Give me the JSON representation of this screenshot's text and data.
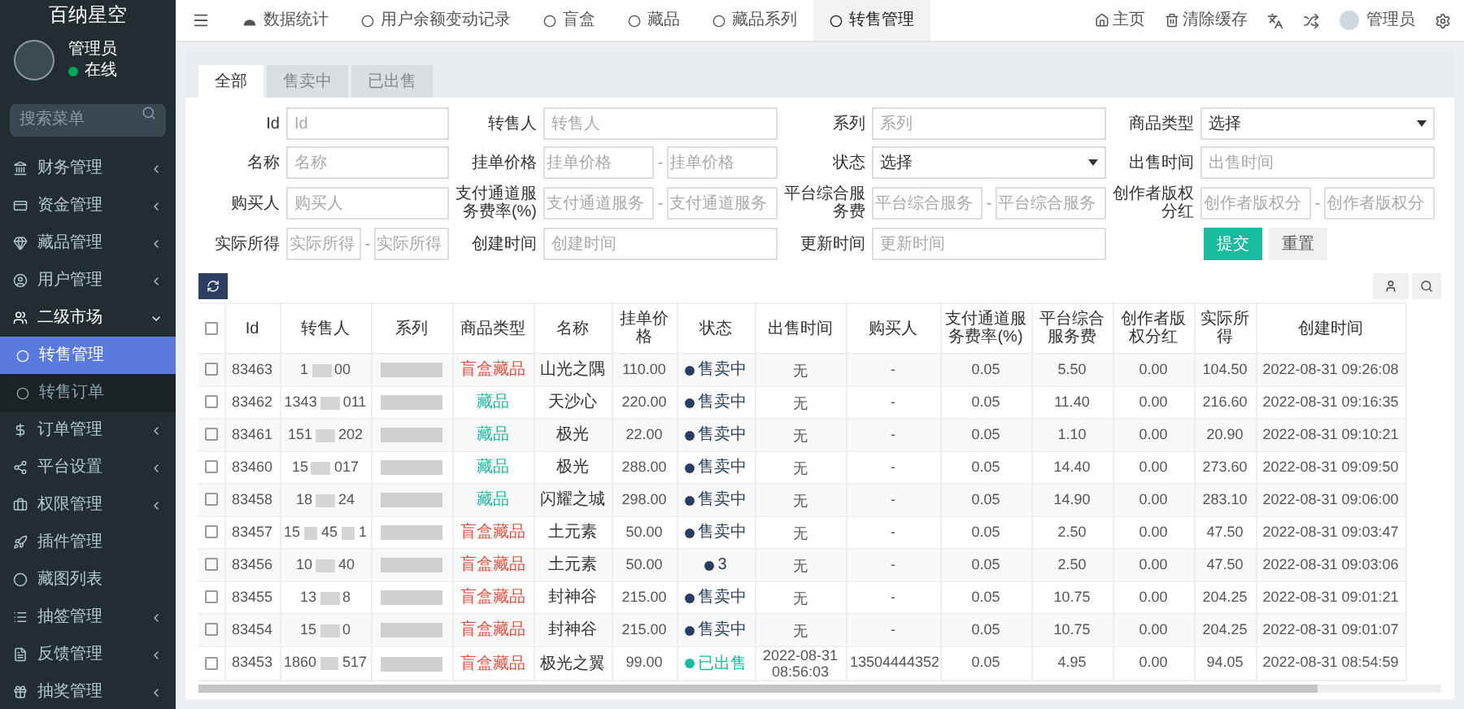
{
  "sidebar": {
    "brand": "百纳星空",
    "user": {
      "name": "管理员",
      "status": "在线",
      "online": true
    },
    "search": {
      "placeholder": "搜索菜单"
    },
    "items": [
      {
        "label": "财务管理",
        "expandable": true,
        "expanded": false
      },
      {
        "label": "资金管理",
        "expandable": true,
        "expanded": false
      },
      {
        "label": "藏品管理",
        "expandable": true,
        "expanded": false
      },
      {
        "label": "用户管理",
        "expandable": true,
        "expanded": false
      },
      {
        "label": "二级市场",
        "expandable": true,
        "expanded": true,
        "children": [
          {
            "label": "转售管理",
            "selected": true
          },
          {
            "label": "转售订单",
            "selected": false
          }
        ]
      },
      {
        "label": "订单管理",
        "expandable": true,
        "expanded": false
      },
      {
        "label": "平台设置",
        "expandable": true,
        "expanded": false
      },
      {
        "label": "权限管理",
        "expandable": true,
        "expanded": false
      },
      {
        "label": "插件管理",
        "expandable": false,
        "expanded": false
      },
      {
        "label": "藏图列表",
        "expandable": false,
        "expanded": false
      },
      {
        "label": "抽签管理",
        "expandable": true,
        "expanded": false
      },
      {
        "label": "反馈管理",
        "expandable": true,
        "expanded": false
      },
      {
        "label": "抽奖管理",
        "expandable": true,
        "expanded": false
      }
    ]
  },
  "top_tabs": [
    {
      "label": "数据统计",
      "selected": false
    },
    {
      "label": "用户余额变动记录",
      "selected": false
    },
    {
      "label": "盲盒",
      "selected": false
    },
    {
      "label": "藏品",
      "selected": false
    },
    {
      "label": "藏品系列",
      "selected": false
    },
    {
      "label": "转售管理",
      "selected": true
    }
  ],
  "top_right": {
    "home": "主页",
    "clear_cache": "清除缓存",
    "user": "管理员"
  },
  "filter_tabs": [
    {
      "label": "全部",
      "selected": true
    },
    {
      "label": "售卖中",
      "selected": false
    },
    {
      "label": "已出售",
      "selected": false
    }
  ],
  "filters": [
    {
      "label": "Id",
      "kind": "text",
      "placeholder": "Id"
    },
    {
      "label": "转售人",
      "kind": "text",
      "placeholder": "转售人"
    },
    {
      "label": "系列",
      "kind": "text",
      "placeholder": "系列"
    },
    {
      "label": "商品类型",
      "kind": "select",
      "value": "选择"
    },
    {
      "label": "名称",
      "kind": "text",
      "placeholder": "名称"
    },
    {
      "label": "挂单价格",
      "kind": "range",
      "placeholders": [
        "挂单价格",
        "挂单价格"
      ],
      "separator": "-"
    },
    {
      "label": "状态",
      "kind": "select",
      "value": "选择"
    },
    {
      "label": "出售时间",
      "kind": "text",
      "placeholder": "出售时间"
    },
    {
      "label": "购买人",
      "kind": "text",
      "placeholder": "购买人"
    },
    {
      "label": "支付通道服务费率(%)",
      "kind": "range",
      "placeholders": [
        "支付通道服务",
        "支付通道服务"
      ],
      "separator": "-"
    },
    {
      "label": "平台综合服务费",
      "kind": "range",
      "placeholders": [
        "平台综合服务",
        "平台综合服务"
      ],
      "separator": "-"
    },
    {
      "label": "创作者版权分红",
      "kind": "range",
      "placeholders": [
        "创作者版权分",
        "创作者版权分"
      ],
      "separator": "-"
    },
    {
      "label": "实际所得",
      "kind": "range",
      "placeholders": [
        "实际所得",
        "实际所得"
      ],
      "separator": "-"
    },
    {
      "label": "创建时间",
      "kind": "text",
      "placeholder": "创建时间"
    },
    {
      "label": "更新时间",
      "kind": "text",
      "placeholder": "更新时间"
    }
  ],
  "filter_buttons": {
    "submit": "提交",
    "reset": "重置"
  },
  "table": {
    "select_all": {
      "checked": false
    },
    "columns": [
      "Id",
      "转售人",
      "系列",
      "商品类型",
      "名称",
      "挂单价格",
      "状态",
      "出售时间",
      "购买人",
      "支付通道服务费率(%)",
      "平台综合服务费",
      "创作者版权分红",
      "实际所得",
      "创建时间"
    ],
    "rows": [
      {
        "checked": false,
        "id": "83463",
        "seller": [
          "1",
          "00"
        ],
        "series_blurred": true,
        "type": {
          "label": "盲盒藏品",
          "color": "#e74c3c"
        },
        "name": "山光之隅",
        "price": "110.00",
        "status": {
          "label": "售卖中",
          "color": "#2c3e60"
        },
        "sold_time": "无",
        "buyer": "-",
        "fee_rate": "0.05",
        "platform_fee": "5.50",
        "creator_share": "0.00",
        "actual": "104.50",
        "created": "2022-08-31 09:26:08"
      },
      {
        "checked": false,
        "id": "83462",
        "seller": [
          "1343",
          "011"
        ],
        "series_blurred": true,
        "type": {
          "label": "藏品",
          "color": "#18bc9c"
        },
        "name": "天沙心",
        "price": "220.00",
        "status": {
          "label": "售卖中",
          "color": "#2c3e60"
        },
        "sold_time": "无",
        "buyer": "-",
        "fee_rate": "0.05",
        "platform_fee": "11.40",
        "creator_share": "0.00",
        "actual": "216.60",
        "created": "2022-08-31 09:16:35"
      },
      {
        "checked": false,
        "id": "83461",
        "seller": [
          "151",
          "202"
        ],
        "series_blurred": true,
        "type": {
          "label": "藏品",
          "color": "#18bc9c"
        },
        "name": "极光",
        "price": "22.00",
        "status": {
          "label": "售卖中",
          "color": "#2c3e60"
        },
        "sold_time": "无",
        "buyer": "-",
        "fee_rate": "0.05",
        "platform_fee": "1.10",
        "creator_share": "0.00",
        "actual": "20.90",
        "created": "2022-08-31 09:10:21"
      },
      {
        "checked": false,
        "id": "83460",
        "seller": [
          "15",
          "017"
        ],
        "series_blurred": true,
        "type": {
          "label": "藏品",
          "color": "#18bc9c"
        },
        "name": "极光",
        "price": "288.00",
        "status": {
          "label": "售卖中",
          "color": "#2c3e60"
        },
        "sold_time": "无",
        "buyer": "-",
        "fee_rate": "0.05",
        "platform_fee": "14.40",
        "creator_share": "0.00",
        "actual": "273.60",
        "created": "2022-08-31 09:09:50"
      },
      {
        "checked": false,
        "id": "83458",
        "seller": [
          "18",
          "24"
        ],
        "series_blurred": true,
        "type": {
          "label": "藏品",
          "color": "#18bc9c"
        },
        "name": "闪耀之城",
        "price": "298.00",
        "status": {
          "label": "售卖中",
          "color": "#2c3e60"
        },
        "sold_time": "无",
        "buyer": "-",
        "fee_rate": "0.05",
        "platform_fee": "14.90",
        "creator_share": "0.00",
        "actual": "283.10",
        "created": "2022-08-31 09:06:00"
      },
      {
        "checked": false,
        "id": "83457",
        "seller": [
          "15",
          "45",
          "1"
        ],
        "series_blurred": true,
        "type": {
          "label": "盲盒藏品",
          "color": "#e74c3c"
        },
        "name": "土元素",
        "price": "50.00",
        "status": {
          "label": "售卖中",
          "color": "#2c3e60"
        },
        "sold_time": "无",
        "buyer": "-",
        "fee_rate": "0.05",
        "platform_fee": "2.50",
        "creator_share": "0.00",
        "actual": "47.50",
        "created": "2022-08-31 09:03:47"
      },
      {
        "checked": false,
        "id": "83456",
        "seller": [
          "10",
          "40"
        ],
        "series_blurred": true,
        "type": {
          "label": "盲盒藏品",
          "color": "#e74c3c"
        },
        "name": "土元素",
        "price": "50.00",
        "status": {
          "label": "3",
          "color": "#2c3e60"
        },
        "sold_time": "无",
        "buyer": "-",
        "fee_rate": "0.05",
        "platform_fee": "2.50",
        "creator_share": "0.00",
        "actual": "47.50",
        "created": "2022-08-31 09:03:06"
      },
      {
        "checked": false,
        "id": "83455",
        "seller": [
          "13",
          "8"
        ],
        "series_blurred": true,
        "type": {
          "label": "盲盒藏品",
          "color": "#e74c3c"
        },
        "name": "封神谷",
        "price": "215.00",
        "status": {
          "label": "售卖中",
          "color": "#2c3e60"
        },
        "sold_time": "无",
        "buyer": "-",
        "fee_rate": "0.05",
        "platform_fee": "10.75",
        "creator_share": "0.00",
        "actual": "204.25",
        "created": "2022-08-31 09:01:21"
      },
      {
        "checked": false,
        "id": "83454",
        "seller": [
          "15",
          "0"
        ],
        "series_blurred": true,
        "type": {
          "label": "盲盒藏品",
          "color": "#e74c3c"
        },
        "name": "封神谷",
        "price": "215.00",
        "status": {
          "label": "售卖中",
          "color": "#2c3e60"
        },
        "sold_time": "无",
        "buyer": "-",
        "fee_rate": "0.05",
        "platform_fee": "10.75",
        "creator_share": "0.00",
        "actual": "204.25",
        "created": "2022-08-31 09:01:07"
      },
      {
        "checked": false,
        "id": "83453",
        "seller": [
          "1860",
          "517"
        ],
        "series_blurred": true,
        "type": {
          "label": "盲盒藏品",
          "color": "#e74c3c"
        },
        "name": "极光之翼",
        "price": "99.00",
        "status": {
          "label": "已出售",
          "color": "#18bc9c"
        },
        "sold_time": "2022-08-31 08:56:03",
        "buyer": "13504444352",
        "fee_rate": "0.05",
        "platform_fee": "4.95",
        "creator_share": "0.00",
        "actual": "94.05",
        "created": "2022-08-31 08:54:59"
      }
    ]
  }
}
